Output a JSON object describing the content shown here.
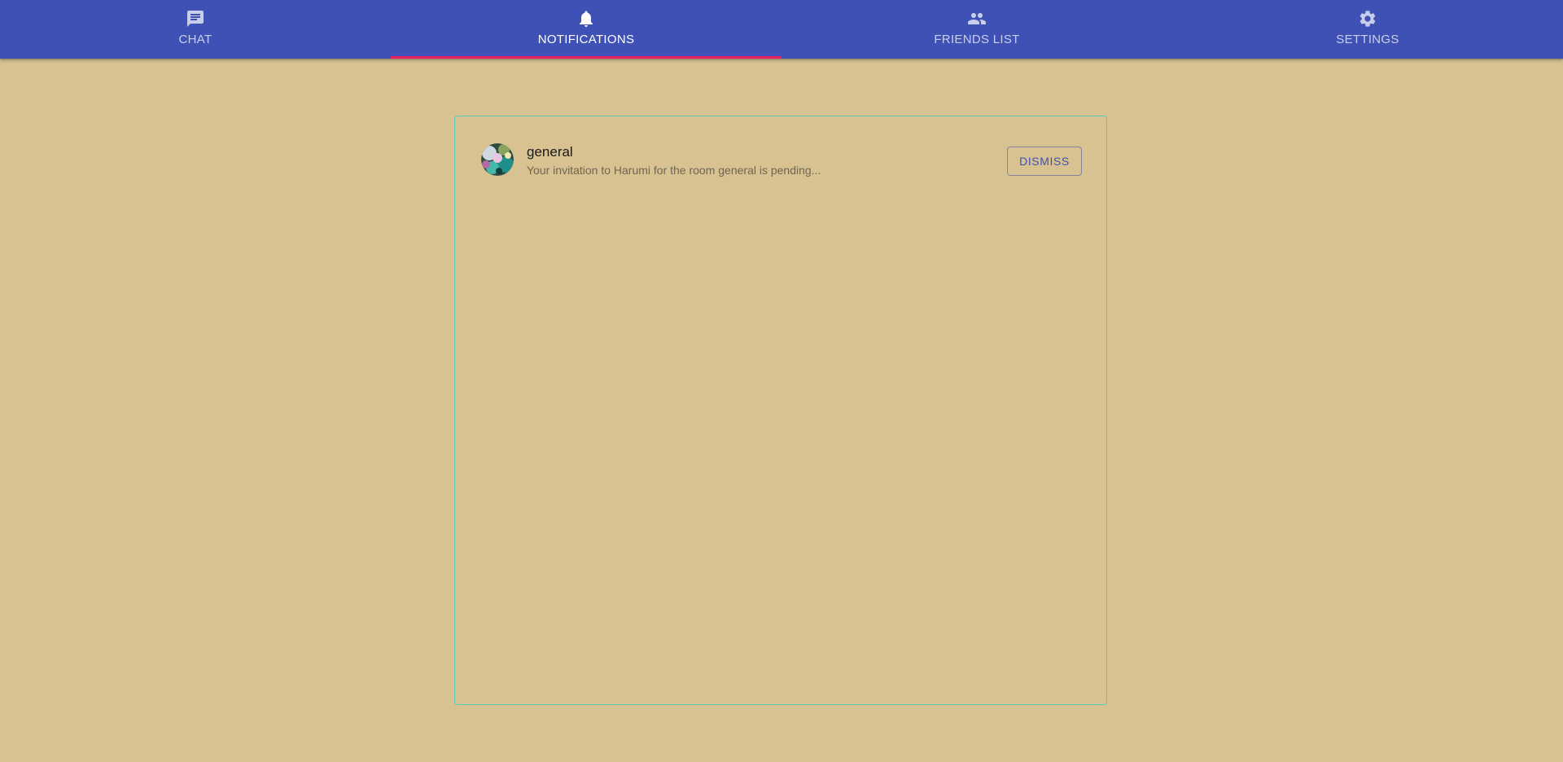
{
  "nav": {
    "tabs": [
      {
        "label": "Chat",
        "icon": "chat-icon",
        "active": false
      },
      {
        "label": "Notifications",
        "icon": "bell-icon",
        "active": true
      },
      {
        "label": "Friends List",
        "icon": "people-icon",
        "active": false
      },
      {
        "label": "Settings",
        "icon": "gear-icon",
        "active": false
      }
    ]
  },
  "notifications": [
    {
      "title": "general",
      "message": "Your invitation to Harumi for the room general is pending...",
      "action_label": "Dismiss",
      "avatar": "room-avatar"
    }
  ],
  "colors": {
    "background": "#d8c291",
    "appbar": "#3f51b5",
    "tab_indicator": "#e91e63",
    "panel_border": "#5fc9b8"
  }
}
